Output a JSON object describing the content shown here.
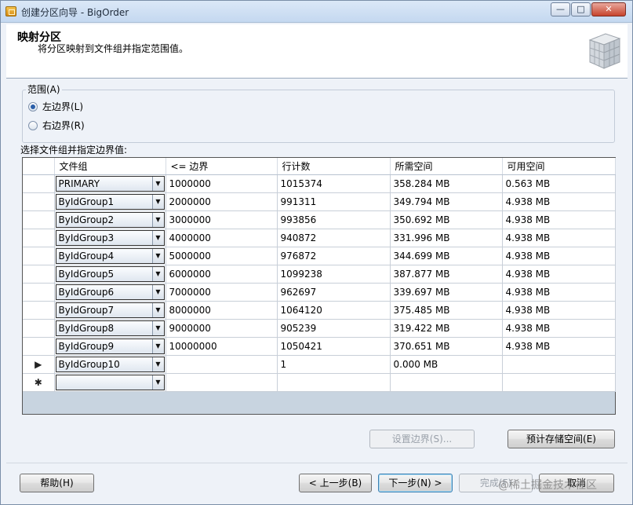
{
  "window": {
    "title": "创建分区向导 - BigOrder",
    "minimize": "—",
    "maximize": "□",
    "close": "✕"
  },
  "header": {
    "title": "映射分区",
    "subtitle": "将分区映射到文件组并指定范围值。"
  },
  "range": {
    "label": "范围(A)",
    "options": [
      {
        "label": "左边界(L)",
        "checked": true
      },
      {
        "label": "右边界(R)",
        "checked": false
      }
    ]
  },
  "grid": {
    "caption": "选择文件组并指定边界值:",
    "columns": [
      "文件组",
      "<= 边界",
      "行计数",
      "所需空间",
      "可用空间"
    ],
    "rows": [
      {
        "marker": "",
        "filegroup": "PRIMARY",
        "boundary": "1000000",
        "rowcount": "1015374",
        "required": "358.284 MB",
        "available": "0.563 MB"
      },
      {
        "marker": "",
        "filegroup": "ByIdGroup1",
        "boundary": "2000000",
        "rowcount": "991311",
        "required": "349.794 MB",
        "available": "4.938 MB"
      },
      {
        "marker": "",
        "filegroup": "ByIdGroup2",
        "boundary": "3000000",
        "rowcount": "993856",
        "required": "350.692 MB",
        "available": "4.938 MB"
      },
      {
        "marker": "",
        "filegroup": "ByIdGroup3",
        "boundary": "4000000",
        "rowcount": "940872",
        "required": "331.996 MB",
        "available": "4.938 MB"
      },
      {
        "marker": "",
        "filegroup": "ByIdGroup4",
        "boundary": "5000000",
        "rowcount": "976872",
        "required": "344.699 MB",
        "available": "4.938 MB"
      },
      {
        "marker": "",
        "filegroup": "ByIdGroup5",
        "boundary": "6000000",
        "rowcount": "1099238",
        "required": "387.877 MB",
        "available": "4.938 MB"
      },
      {
        "marker": "",
        "filegroup": "ByIdGroup6",
        "boundary": "7000000",
        "rowcount": "962697",
        "required": "339.697 MB",
        "available": "4.938 MB"
      },
      {
        "marker": "",
        "filegroup": "ByIdGroup7",
        "boundary": "8000000",
        "rowcount": "1064120",
        "required": "375.485 MB",
        "available": "4.938 MB"
      },
      {
        "marker": "",
        "filegroup": "ByIdGroup8",
        "boundary": "9000000",
        "rowcount": "905239",
        "required": "319.422 MB",
        "available": "4.938 MB"
      },
      {
        "marker": "",
        "filegroup": "ByIdGroup9",
        "boundary": "10000000",
        "rowcount": "1050421",
        "required": "370.651 MB",
        "available": "4.938 MB"
      },
      {
        "marker": "▶",
        "filegroup": "ByIdGroup10",
        "boundary": "",
        "rowcount": "1",
        "required": "0.000 MB",
        "available": ""
      },
      {
        "marker": "✱",
        "filegroup": "",
        "boundary": "",
        "rowcount": "",
        "required": "",
        "available": ""
      }
    ]
  },
  "buttons": {
    "set_boundary": "设置边界(S)...",
    "estimate_storage": "预计存储空间(E)",
    "help": "帮助(H)",
    "back": "< 上一步(B)",
    "next": "下一步(N) >",
    "finish": "完成(F)",
    "cancel": "取消"
  },
  "watermark": "@稀土掘金技术社区",
  "icons": {
    "app": "wizard-app-icon",
    "header_logo": "partition-cube-icon",
    "dropdown": "chevron-down-icon"
  }
}
